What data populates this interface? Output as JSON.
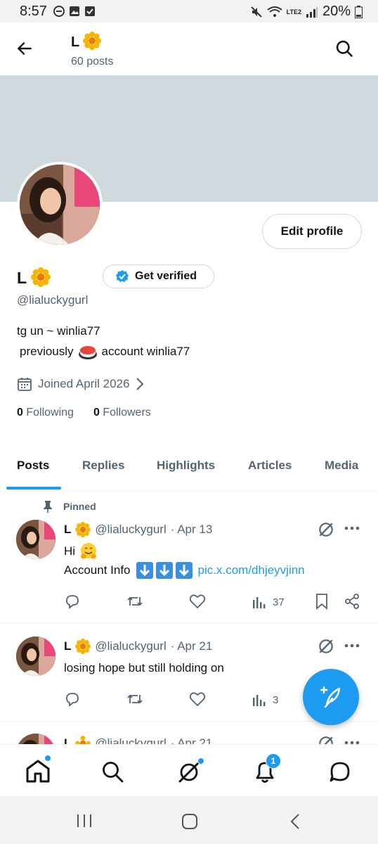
{
  "status_bar": {
    "time": "8:57",
    "battery": "20%",
    "network": "LTE2"
  },
  "header": {
    "title": "L",
    "post_count": "60 posts"
  },
  "profile": {
    "edit_label": "Edit profile",
    "name": "L",
    "verify_label": "Get verified",
    "handle": "@lialuckygurl",
    "bio_line1": "tg un ~ winlia77",
    "bio_line2_prefix": "previously",
    "bio_line2_suffix": "account winlia77",
    "joined": "Joined April 2026",
    "following_count": "0",
    "following_label": "Following",
    "followers_count": "0",
    "followers_label": "Followers"
  },
  "tabs": [
    {
      "label": "Posts"
    },
    {
      "label": "Replies"
    },
    {
      "label": "Highlights"
    },
    {
      "label": "Articles"
    },
    {
      "label": "Media"
    }
  ],
  "pinned_label": "Pinned",
  "tweets": [
    {
      "name": "L",
      "handle": "@lialuckygurl",
      "date": "· Apr 13",
      "line1": "Hi",
      "line2_prefix": "Account Info",
      "link": "pic.x.com/dhjeyvjinn",
      "views": "37"
    },
    {
      "name": "L",
      "handle": "@lialuckygurl",
      "date": "· Apr 21",
      "line1": "losing hope but still holding on",
      "views": "3"
    },
    {
      "name": "L",
      "handle": "@lialuckygurl",
      "date": "· Apr 21"
    }
  ],
  "nav": {
    "notification_badge": "1"
  },
  "colors": {
    "accent": "#1d9bf0",
    "banner": "#cfd9de",
    "secondary_text": "#536471"
  }
}
